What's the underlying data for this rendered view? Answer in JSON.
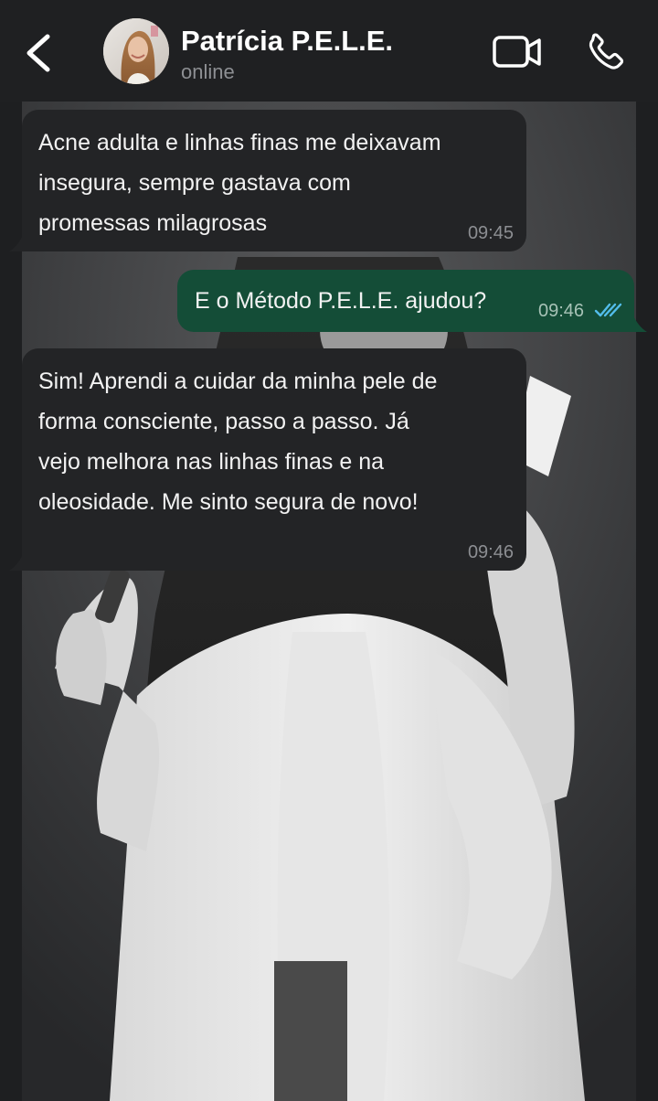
{
  "header": {
    "back_icon": "chevron-left-icon",
    "contact_name": "Patrícia P.E.L.E.",
    "status": "online",
    "video_icon": "video-camera-icon",
    "call_icon": "phone-icon"
  },
  "messages": [
    {
      "direction": "incoming",
      "text": "Acne adulta e linhas finas me deixavam\ninsegura, sempre gastava com\npromessas milagrosas",
      "time": "09:45"
    },
    {
      "direction": "outgoing",
      "text": "E o Método P.E.L.E. ajudou?",
      "time": "09:46",
      "read_receipt": "double-check-read",
      "receipt_color": "#53bdeb"
    },
    {
      "direction": "incoming",
      "text": "Sim! Aprendi a cuidar da minha pele de\nforma consciente, passo a passo. Já\nvejo melhora nas linhas finas e na\noleosidade. Me sinto segura de novo!",
      "time": "09:46"
    }
  ],
  "colors": {
    "header_bg": "#1f2022",
    "incoming_bubble": "#232426",
    "outgoing_bubble": "#144d37",
    "read_tick": "#53bdeb"
  }
}
